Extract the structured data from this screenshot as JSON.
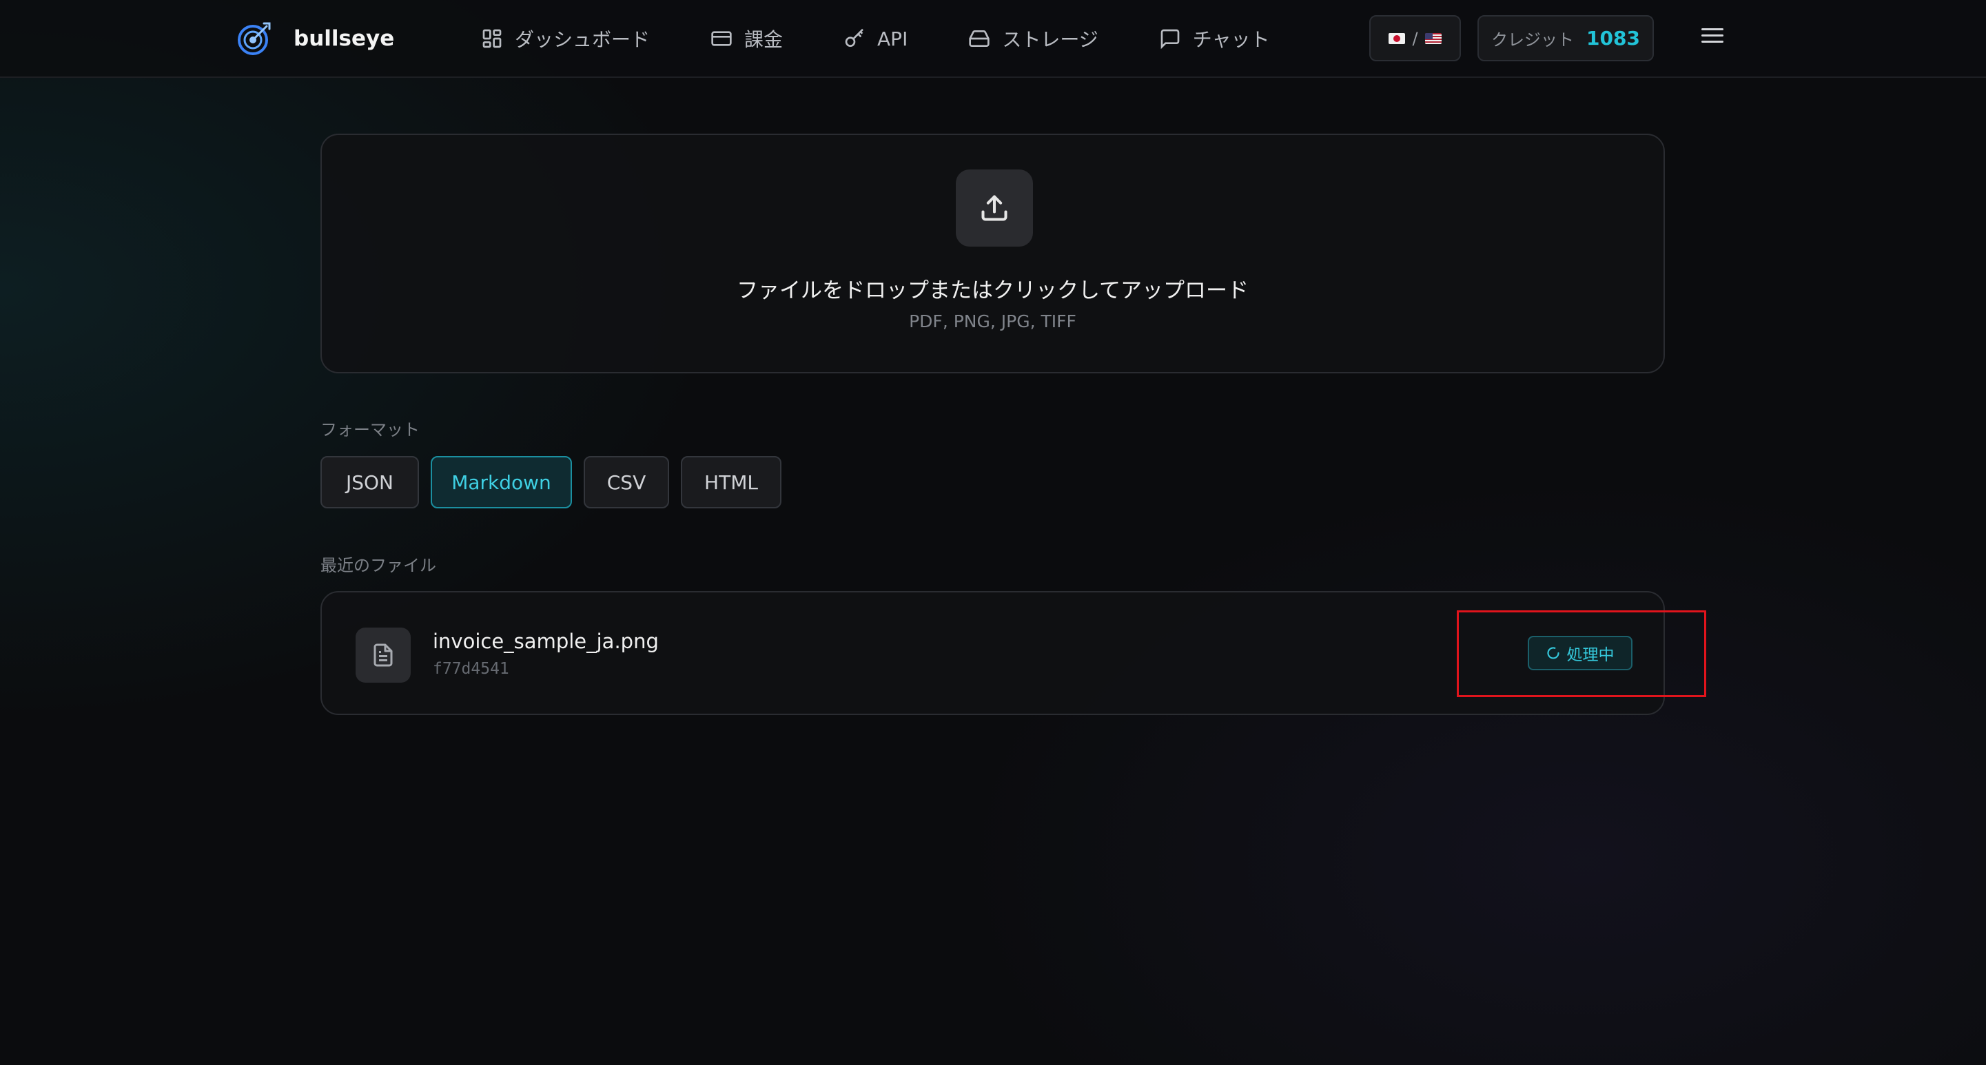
{
  "header": {
    "brand": "bullseye",
    "nav": [
      {
        "label": "ダッシュボード",
        "icon": "dashboard-icon"
      },
      {
        "label": "課金",
        "icon": "credit-card-icon"
      },
      {
        "label": "API",
        "icon": "key-icon"
      },
      {
        "label": "ストレージ",
        "icon": "storage-icon"
      },
      {
        "label": "チャット",
        "icon": "chat-icon"
      }
    ],
    "lang_separator": "/",
    "credits": {
      "label": "クレジット",
      "value": "1083"
    }
  },
  "upload": {
    "title": "ファイルをドロップまたはクリックしてアップロード",
    "formats": "PDF, PNG, JPG, TIFF",
    "icon": "upload-icon"
  },
  "format": {
    "label": "フォーマット",
    "options": [
      "JSON",
      "Markdown",
      "CSV",
      "HTML"
    ],
    "selected": "Markdown"
  },
  "recent": {
    "label": "最近のファイル",
    "files": [
      {
        "name": "invoice_sample_ja.png",
        "id": "f77d4541",
        "status": "処理中",
        "icon": "document-icon"
      }
    ]
  },
  "colors": {
    "accent": "#22c3d8",
    "highlight": "#e0141c",
    "background": "#0b0c0e"
  }
}
